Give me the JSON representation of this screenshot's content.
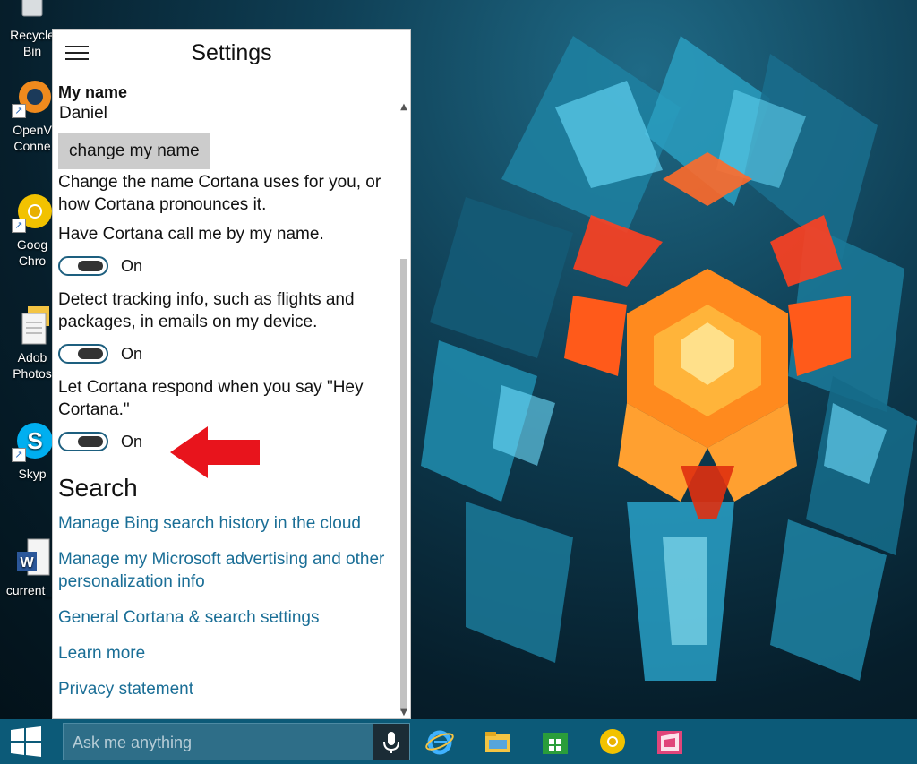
{
  "desktop": {
    "icons": [
      {
        "label": "Recycle Bin",
        "icon": "recycle-bin-icon"
      },
      {
        "label": "OpenV",
        "label2": "Conne",
        "icon": "openvpn-icon"
      },
      {
        "label": "Goog",
        "label2": "Chro",
        "icon": "chrome-icon"
      },
      {
        "label": "Adob",
        "label2": "Photos",
        "icon": "photoshop-icon"
      },
      {
        "label": "Skyp",
        "icon": "skype-icon"
      },
      {
        "label": "current_c",
        "icon": "word-document-icon"
      }
    ]
  },
  "panel": {
    "title": "Settings",
    "my_name_label": "My name",
    "my_name_value": "Daniel",
    "change_name_button": "change my name",
    "change_name_desc": "Change the name Cortana uses for you, or how Cortana pronounces it.",
    "settings": [
      {
        "label": "Have Cortana call me by my name.",
        "state": "On"
      },
      {
        "label": "Detect tracking info, such as flights and packages, in emails on my device.",
        "state": "On"
      },
      {
        "label": "Let Cortana respond when you say \"Hey Cortana.\"",
        "state": "On"
      }
    ],
    "search_section_title": "Search",
    "links": [
      "Manage Bing search history in the cloud",
      "Manage my Microsoft advertising and other personalization info",
      "General Cortana & search settings",
      "Learn more",
      "Privacy statement"
    ]
  },
  "taskbar": {
    "search_placeholder": "Ask me anything",
    "pinned": [
      "internet-explorer-icon",
      "file-explorer-icon",
      "store-icon",
      "chrome-icon",
      "app-icon"
    ]
  },
  "colors": {
    "link": "#1a6e96",
    "toggle_border": "#1d5f7f",
    "taskbar": "#0c5a78",
    "annotation_arrow": "#e8141c"
  }
}
